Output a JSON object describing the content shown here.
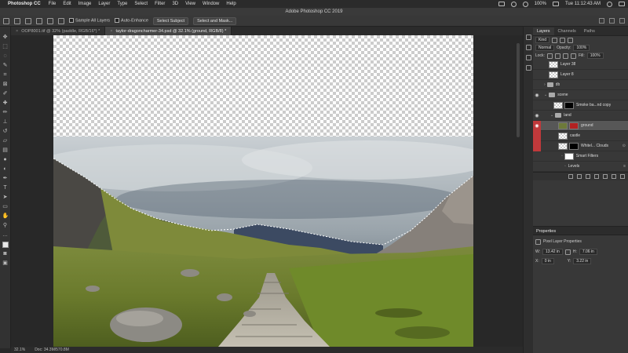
{
  "menubar": {
    "app": "Photoshop CC",
    "items": [
      "File",
      "Edit",
      "Image",
      "Layer",
      "Type",
      "Select",
      "Filter",
      "3D",
      "View",
      "Window",
      "Help"
    ],
    "battery": "100%",
    "clock": "Tue 11:12:43 AM"
  },
  "window": {
    "title": "Adobe Photoshop CC 2019"
  },
  "options": {
    "sample_all_layers": "Sample All Layers",
    "auto_enhance": "Auto-Enhance",
    "select_subject": "Select Subject",
    "select_and_mask": "Select and Mask..."
  },
  "tabs": [
    {
      "label": "OOP8001.tif @ 32% (paddle, RGB/16*) *",
      "active": false
    },
    {
      "label": "taylor-dragoncharmer-34.psd @ 32.1% (ground, RGB/8) *",
      "active": true
    }
  ],
  "status": {
    "zoom": "32.1%",
    "doc": "Doc: 34.3M/570.8M"
  },
  "panels": {
    "tabs": [
      "Layers",
      "Channels",
      "Paths"
    ],
    "kind": "Kind",
    "blend_mode": "Normal",
    "opacity_label": "Opacity:",
    "opacity": "100%",
    "lock_label": "Lock:",
    "fill_label": "Fill:",
    "fill": "100%",
    "layers": [
      {
        "name": "Layer 38",
        "visible": false,
        "type": "pixel",
        "indent": 0
      },
      {
        "name": "Layer 8",
        "visible": false,
        "type": "pixel",
        "indent": 0
      },
      {
        "name": "db",
        "visible": false,
        "type": "group",
        "indent": 0
      },
      {
        "name": "scene",
        "visible": true,
        "type": "group",
        "indent": 0
      },
      {
        "name": "Smoke ba...nd copy",
        "visible": false,
        "type": "masked",
        "indent": 1
      },
      {
        "name": "land",
        "visible": true,
        "type": "group",
        "indent": 1
      },
      {
        "name": "ground",
        "visible": true,
        "type": "masked",
        "indent": 2,
        "selected": true
      },
      {
        "name": "castle",
        "visible": false,
        "type": "pixel",
        "indent": 2
      },
      {
        "name": "Whitel... Clouds",
        "visible": false,
        "type": "masked",
        "indent": 2
      },
      {
        "name": "Smart Filters",
        "visible": false,
        "type": "filter",
        "indent": 3
      },
      {
        "name": "Levels",
        "visible": false,
        "type": "adjust",
        "indent": 3
      }
    ],
    "properties": {
      "title": "Properties",
      "subtitle": "Pixel Layer Properties",
      "w_label": "W:",
      "w": "13.42 in",
      "h_label": "H:",
      "h": "7.06 in",
      "x_label": "X:",
      "x": "0 in",
      "y_label": "Y:",
      "y": "3.22 in"
    }
  }
}
